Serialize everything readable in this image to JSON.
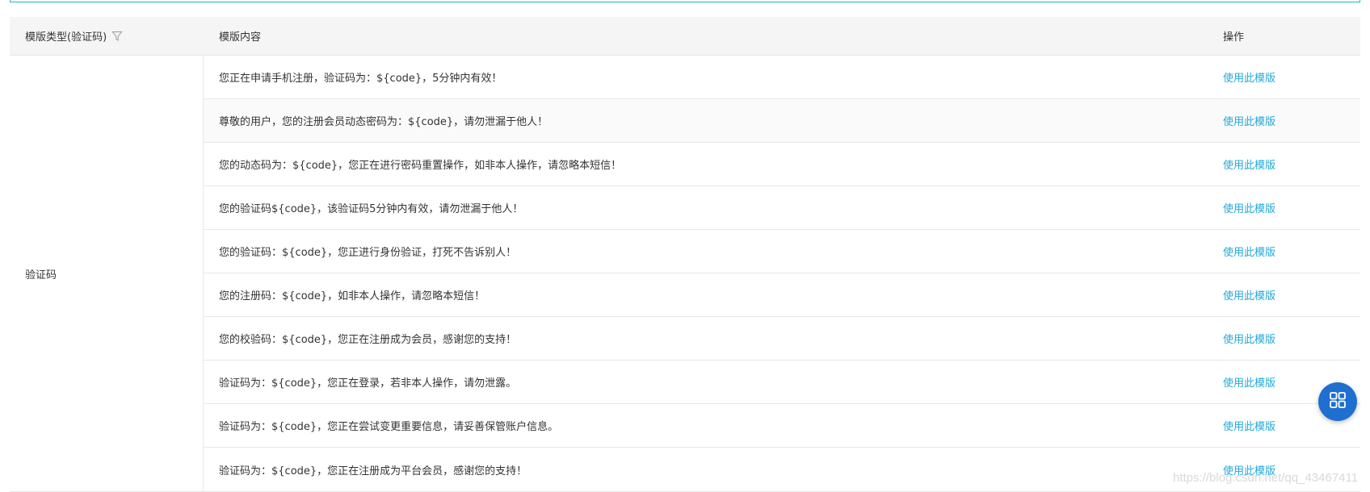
{
  "table": {
    "headers": {
      "type": "模版类型(验证码)",
      "content": "模版内容",
      "operation": "操作"
    },
    "type_value": "验证码",
    "action_label": "使用此模版",
    "rows": [
      {
        "content": "您正在申请手机注册，验证码为：${code}，5分钟内有效！"
      },
      {
        "content": "尊敬的用户，您的注册会员动态密码为：${code}，请勿泄漏于他人！"
      },
      {
        "content": "您的动态码为：${code}，您正在进行密码重置操作，如非本人操作，请忽略本短信！"
      },
      {
        "content": "您的验证码${code}，该验证码5分钟内有效，请勿泄漏于他人！"
      },
      {
        "content": "您的验证码：${code}，您正进行身份验证，打死不告诉别人！"
      },
      {
        "content": "您的注册码：${code}，如非本人操作，请忽略本短信！"
      },
      {
        "content": "您的校验码：${code}，您正在注册成为会员，感谢您的支持！"
      },
      {
        "content": "验证码为：${code}，您正在登录，若非本人操作，请勿泄露。"
      },
      {
        "content": "验证码为：${code}，您正在尝试变更重要信息，请妥善保管账户信息。"
      },
      {
        "content": "验证码为：${code}，您正在注册成为平台会员，感谢您的支持！"
      }
    ]
  },
  "icons": {
    "filter": "filter-icon",
    "fab": "grid-icon"
  },
  "colors": {
    "accent_link": "#21a8d8",
    "fab_bg": "#1f6fd1",
    "top_border": "#21b8c6"
  },
  "watermark": "https://blog.csdn.net/qq_43467411"
}
